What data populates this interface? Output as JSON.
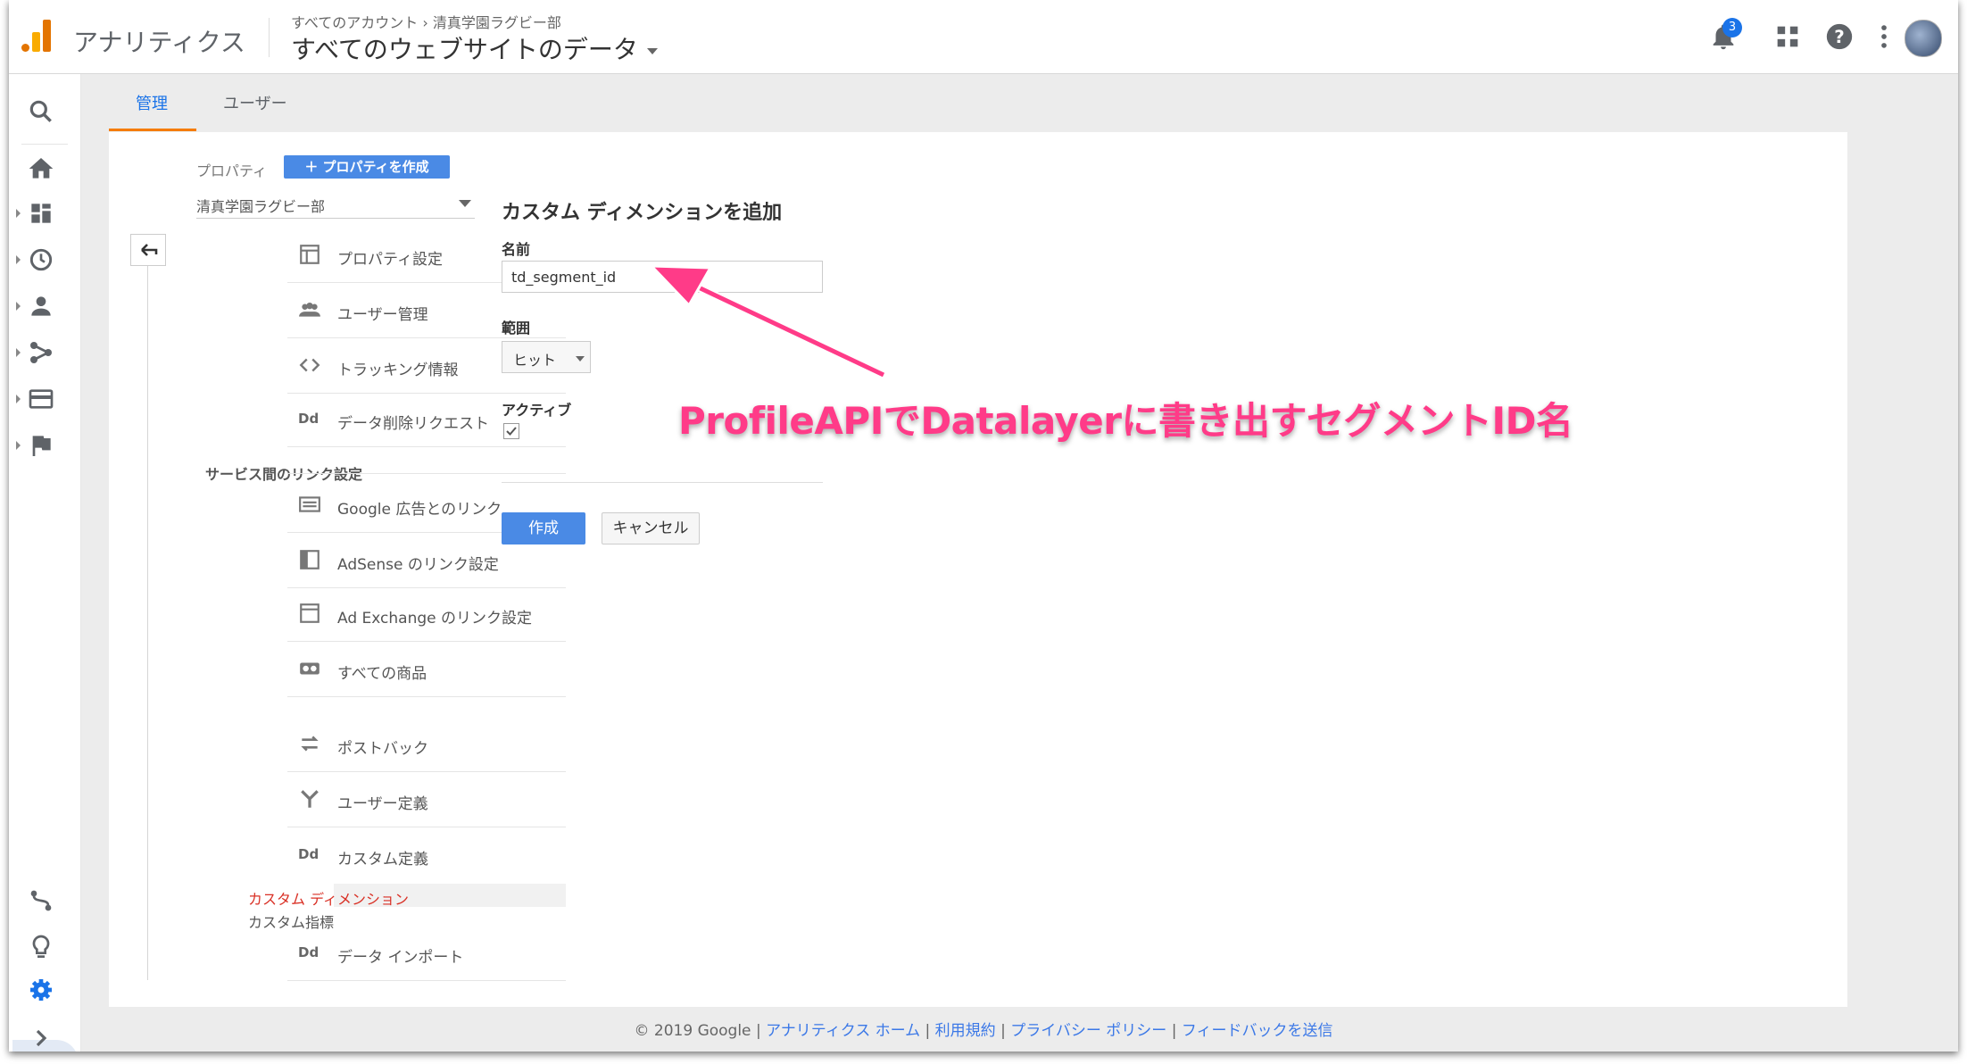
{
  "topbar": {
    "app_title": "アナリティクス",
    "breadcrumb_all": "すべてのアカウント",
    "breadcrumb_sep": "›",
    "breadcrumb_account": "清真学園ラグビー部",
    "property_title": "すべてのウェブサイトのデータ",
    "notification_count": "3"
  },
  "tabs": {
    "admin": "管理",
    "user": "ユーザー"
  },
  "property_column": {
    "label": "プロパティ",
    "create_button": "＋ プロパティを作成",
    "selected_property": "清真学園ラグビー部",
    "items": [
      "プロパティ設定",
      "ユーザー管理",
      "トラッキング情報",
      "データ削除リクエスト"
    ],
    "service_heading": "サービス間のリンク設定",
    "link_items": [
      "Google 広告とのリンク",
      "AdSense のリンク設定",
      "Ad Exchange のリンク設定",
      "すべての商品"
    ],
    "other_items": [
      "ポストバック",
      "ユーザー定義",
      "カスタム定義"
    ],
    "custom_sub": [
      "カスタム ディメンション",
      "カスタム指標"
    ],
    "data_import": "データ インポート"
  },
  "form": {
    "title": "カスタム ディメンションを追加",
    "name_label": "名前",
    "name_value": "td_segment_id",
    "scope_label": "範囲",
    "scope_value": "ヒット",
    "active_label": "アクティブ",
    "active_checked": true,
    "create_button": "作成",
    "cancel_button": "キャンセル"
  },
  "annotation": "ProfileAPIでDatalayerに書き出すセグメントID名",
  "footer": {
    "copyright": "© 2019 Google",
    "sep": "|",
    "links": [
      "アナリティクス ホーム",
      "利用規約",
      "プライバシー ポリシー",
      "フィードバックを送信"
    ]
  },
  "colors": {
    "accent_blue": "#4a8ae5",
    "active_tab": "#f57c00",
    "annotation_pink": "#ff3b88",
    "selected_red": "#d93025"
  }
}
